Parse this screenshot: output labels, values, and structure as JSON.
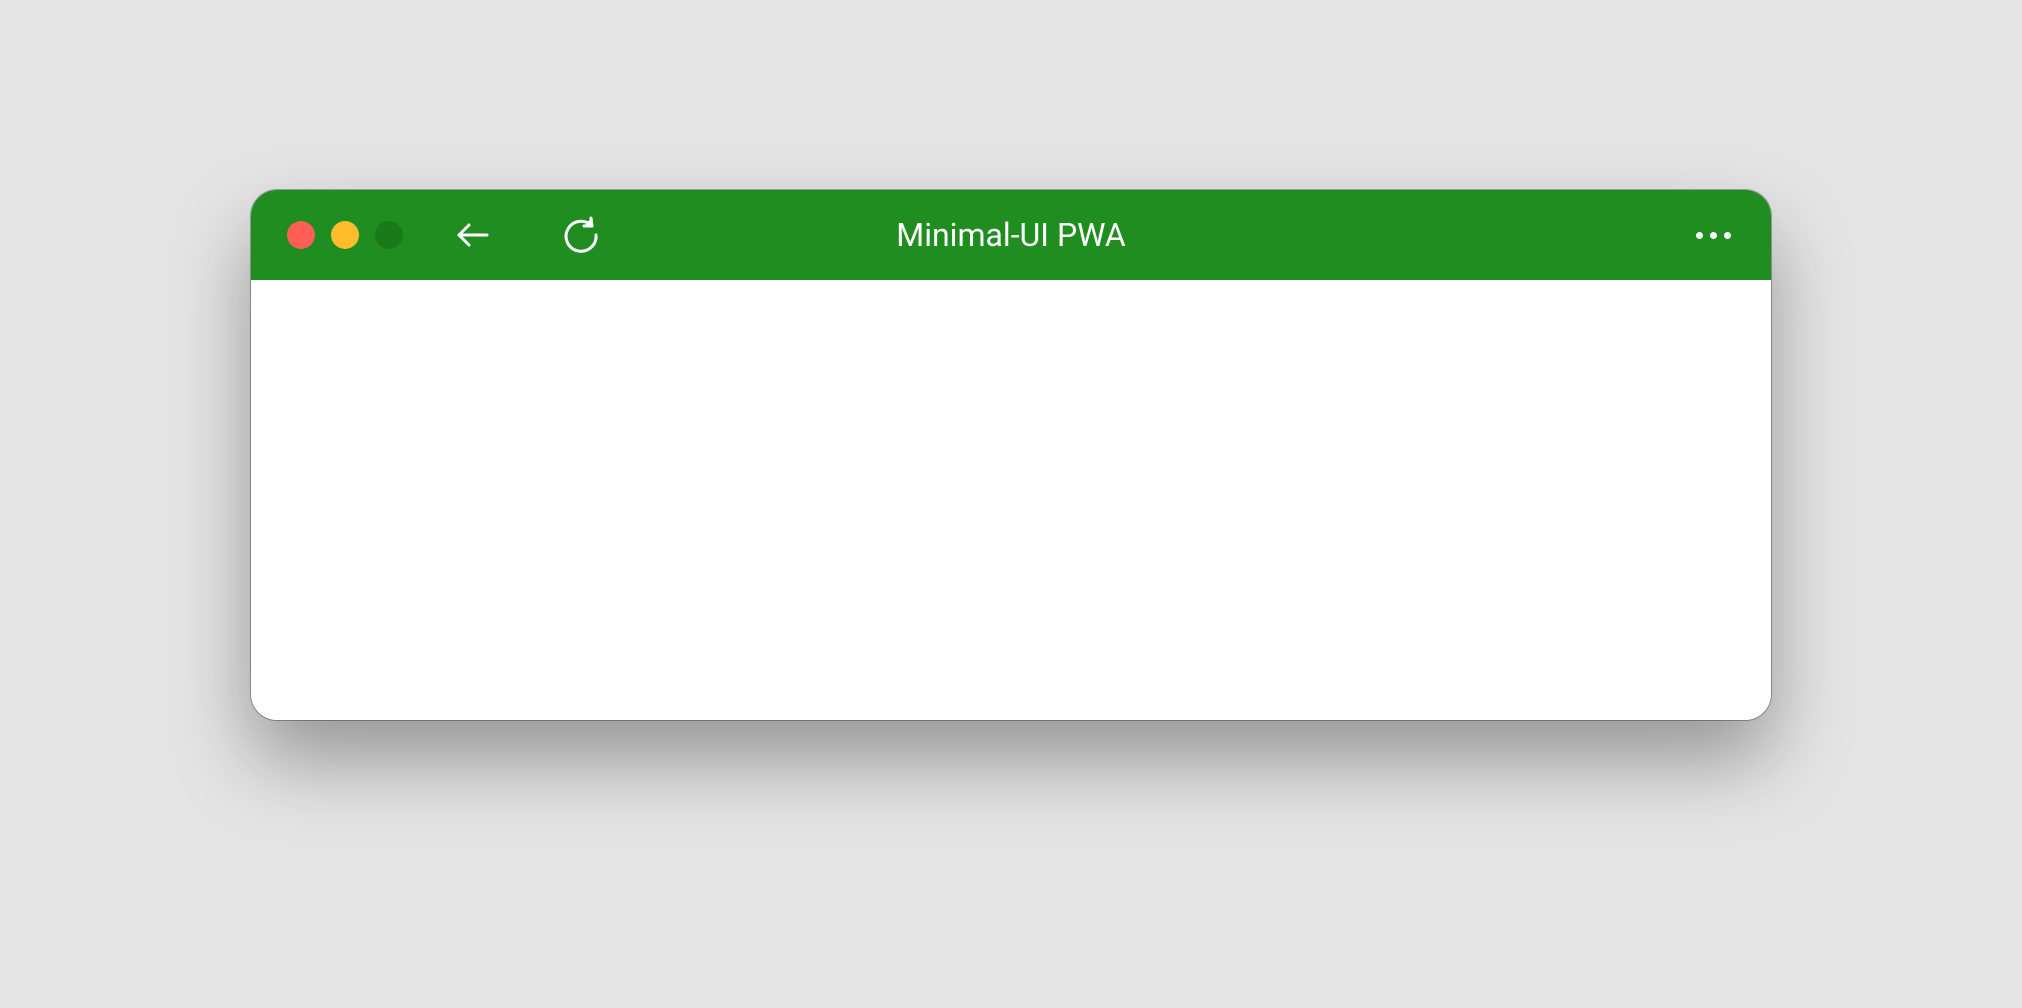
{
  "window": {
    "title": "Minimal-UI PWA",
    "theme_color": "#1f8d1f",
    "traffic_lights": {
      "close": "close",
      "minimize": "minimize",
      "maximize": "maximize"
    },
    "controls": {
      "back": "back",
      "reload": "reload",
      "menu": "menu"
    }
  }
}
